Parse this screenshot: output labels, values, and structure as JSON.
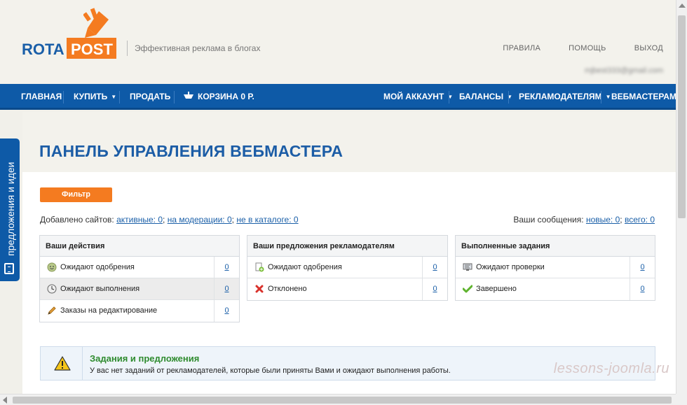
{
  "brand": {
    "rota": "ROTA",
    "post": "POST",
    "tagline": "Эффективная реклама в блогах",
    "accent": "#f47b20",
    "primary": "#0e5aa7"
  },
  "top_links": [
    "ПРАВИЛА",
    "ПОМОЩЬ",
    "ВЫХОД"
  ],
  "user_email": "mjbest333@gmail.com",
  "nav": {
    "home": "ГЛАВНАЯ",
    "buy": "КУПИТЬ",
    "sell": "ПРОДАТЬ",
    "cart": "КОРЗИНА 0 Р.",
    "account": "МОЙ АККАУНТ",
    "balances": "БАЛАНСЫ",
    "advertisers": "РЕКЛАМОДАТЕЛЯМ",
    "webmasters": "ВЕБМАСТЕРАМ"
  },
  "side_tab": "предложения и идеи",
  "page_title": "ПАНЕЛЬ УПРАВЛЕНИЯ ВЕБМАСТЕРА",
  "filter_label": "Фильтр",
  "sites_stats": {
    "prefix": "Добавлено сайтов:",
    "active": "активные: 0",
    "moderation": "на модерации: 0",
    "not_in_catalog": "не в каталоге: 0",
    "sep": ";"
  },
  "messages_stats": {
    "prefix": "Ваши сообщения:",
    "new": "новые: 0",
    "all": "всего: 0",
    "sep": ";"
  },
  "boxes": [
    {
      "title": "Ваши действия",
      "rows": [
        {
          "label": "Ожидают одобрения",
          "count": "0",
          "icon": "clock-smiley-icon"
        },
        {
          "label": "Ожидают выполнения",
          "count": "0",
          "icon": "clock-icon"
        },
        {
          "label": "Заказы на редактирование",
          "count": "0",
          "icon": "pencil-icon"
        }
      ]
    },
    {
      "title": "Ваши предложения рекламодателям",
      "rows": [
        {
          "label": "Ожидают одобрения",
          "count": "0",
          "icon": "document-add-icon"
        },
        {
          "label": "Отклонено",
          "count": "0",
          "icon": "cross-icon"
        }
      ]
    },
    {
      "title": "Выполненные задания",
      "rows": [
        {
          "label": "Ожидают проверки",
          "count": "0",
          "icon": "monitor-icon"
        },
        {
          "label": "Завершено",
          "count": "0",
          "icon": "checkmark-icon"
        }
      ]
    }
  ],
  "notice": {
    "title": "Задания и предложения",
    "text": "У вас нет заданий от рекламодателей, которые были приняты Вами и ожидают выполнения работы."
  },
  "watermark": "lessons-joomla.ru"
}
